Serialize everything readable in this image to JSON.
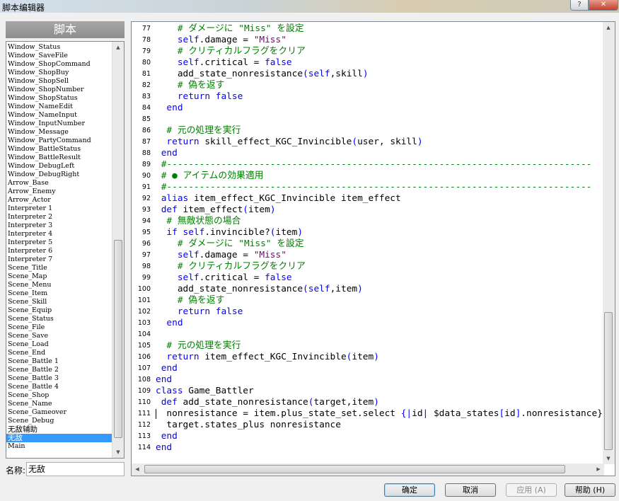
{
  "window": {
    "title": "脚本编辑器",
    "help_glyph": "?",
    "close_glyph": "✕"
  },
  "left": {
    "header": "脚本",
    "items": [
      "Window_Status",
      "Window_SaveFile",
      "Window_ShopCommand",
      "Window_ShopBuy",
      "Window_ShopSell",
      "Window_ShopNumber",
      "Window_ShopStatus",
      "Window_NameEdit",
      "Window_NameInput",
      "Window_InputNumber",
      "Window_Message",
      "Window_PartyCommand",
      "Window_BattleStatus",
      "Window_BattleResult",
      "Window_DebugLeft",
      "Window_DebugRight",
      "Arrow_Base",
      "Arrow_Enemy",
      "Arrow_Actor",
      "Interpreter 1",
      "Interpreter 2",
      "Interpreter 3",
      "Interpreter 4",
      "Interpreter 5",
      "Interpreter 6",
      "Interpreter 7",
      "Scene_Title",
      "Scene_Map",
      "Scene_Menu",
      "Scene_Item",
      "Scene_Skill",
      "Scene_Equip",
      "Scene_Status",
      "Scene_File",
      "Scene_Save",
      "Scene_Load",
      "Scene_End",
      "Scene_Battle 1",
      "Scene_Battle 2",
      "Scene_Battle 3",
      "Scene_Battle 4",
      "Scene_Shop",
      "Scene_Name",
      "Scene_Gameover",
      "Scene_Debug",
      "无敌辅助",
      "无敌",
      "Main"
    ],
    "selected_index": 46,
    "name_label": "名称:",
    "name_value": "无敌"
  },
  "editor": {
    "lines": [
      {
        "n": "77",
        "segs": [
          [
            "    # ダメージに \"Miss\" を設定",
            "#008000"
          ]
        ]
      },
      {
        "n": "78",
        "segs": [
          [
            "    self",
            "#0000ff"
          ],
          [
            ".damage = ",
            "#000000"
          ],
          [
            "\"Miss\"",
            "#800080"
          ]
        ]
      },
      {
        "n": "79",
        "segs": [
          [
            "    # クリティカルフラグをクリア",
            "#008000"
          ]
        ]
      },
      {
        "n": "80",
        "segs": [
          [
            "    self",
            "#0000ff"
          ],
          [
            ".critical = ",
            "#000000"
          ],
          [
            "false",
            "#0000ff"
          ]
        ]
      },
      {
        "n": "81",
        "segs": [
          [
            "    add_state_nonresistance",
            "#000000"
          ],
          [
            "(",
            "#0000ff"
          ],
          [
            "self",
            "#0000ff"
          ],
          [
            ",skill",
            "#000000"
          ],
          [
            ")",
            "#0000ff"
          ]
        ]
      },
      {
        "n": "82",
        "segs": [
          [
            "    # 偽を返す",
            "#008000"
          ]
        ]
      },
      {
        "n": "83",
        "segs": [
          [
            "    return false",
            "#0000ff"
          ]
        ]
      },
      {
        "n": "84",
        "segs": [
          [
            "  end",
            "#0000ff"
          ]
        ]
      },
      {
        "n": "85",
        "segs": [
          [
            "",
            "#000000"
          ]
        ]
      },
      {
        "n": "86",
        "segs": [
          [
            "  # 元の処理を実行",
            "#008000"
          ]
        ]
      },
      {
        "n": "87",
        "segs": [
          [
            "  return",
            "#0000ff"
          ],
          [
            " skill_effect_KGC_Invincible",
            "#000000"
          ],
          [
            "(",
            "#0000ff"
          ],
          [
            "user, skill",
            "#000000"
          ],
          [
            ")",
            "#0000ff"
          ]
        ]
      },
      {
        "n": "88",
        "segs": [
          [
            " end",
            "#0000ff"
          ]
        ]
      },
      {
        "n": "89",
        "segs": [
          [
            " #------------------------------------------------------------------------------",
            "#008000"
          ]
        ]
      },
      {
        "n": "90",
        "segs": [
          [
            " # ● アイテムの効果適用",
            "#008000"
          ]
        ]
      },
      {
        "n": "91",
        "segs": [
          [
            " #------------------------------------------------------------------------------",
            "#008000"
          ]
        ]
      },
      {
        "n": "92",
        "segs": [
          [
            " alias",
            "#0000ff"
          ],
          [
            " item_effect_KGC_Invincible item_effect",
            "#000000"
          ]
        ]
      },
      {
        "n": "93",
        "segs": [
          [
            " def",
            "#0000ff"
          ],
          [
            " item_effect",
            "#000000"
          ],
          [
            "(",
            "#0000ff"
          ],
          [
            "item",
            "#000000"
          ],
          [
            ")",
            "#0000ff"
          ]
        ]
      },
      {
        "n": "94",
        "segs": [
          [
            "  # 無敵状態の場合",
            "#008000"
          ]
        ]
      },
      {
        "n": "95",
        "segs": [
          [
            "  if self",
            "#0000ff"
          ],
          [
            ".invincible?",
            "#000000"
          ],
          [
            "(",
            "#0000ff"
          ],
          [
            "item",
            "#000000"
          ],
          [
            ")",
            "#0000ff"
          ]
        ]
      },
      {
        "n": "96",
        "segs": [
          [
            "    # ダメージに \"Miss\" を設定",
            "#008000"
          ]
        ]
      },
      {
        "n": "97",
        "segs": [
          [
            "    self",
            "#0000ff"
          ],
          [
            ".damage = ",
            "#000000"
          ],
          [
            "\"Miss\"",
            "#800080"
          ]
        ]
      },
      {
        "n": "98",
        "segs": [
          [
            "    # クリティカルフラグをクリア",
            "#008000"
          ]
        ]
      },
      {
        "n": "99",
        "segs": [
          [
            "    self",
            "#0000ff"
          ],
          [
            ".critical = ",
            "#000000"
          ],
          [
            "false",
            "#0000ff"
          ]
        ]
      },
      {
        "n": "100",
        "segs": [
          [
            "    add_state_nonresistance",
            "#000000"
          ],
          [
            "(",
            "#0000ff"
          ],
          [
            "self",
            "#0000ff"
          ],
          [
            ",item",
            "#000000"
          ],
          [
            ")",
            "#0000ff"
          ]
        ]
      },
      {
        "n": "101",
        "segs": [
          [
            "    # 偽を返す",
            "#008000"
          ]
        ]
      },
      {
        "n": "102",
        "segs": [
          [
            "    return false",
            "#0000ff"
          ]
        ]
      },
      {
        "n": "103",
        "segs": [
          [
            "  end",
            "#0000ff"
          ]
        ]
      },
      {
        "n": "104",
        "segs": [
          [
            "",
            "#000000"
          ]
        ]
      },
      {
        "n": "105",
        "segs": [
          [
            "  # 元の処理を実行",
            "#008000"
          ]
        ]
      },
      {
        "n": "106",
        "segs": [
          [
            "  return",
            "#0000ff"
          ],
          [
            " item_effect_KGC_Invincible",
            "#000000"
          ],
          [
            "(",
            "#0000ff"
          ],
          [
            "item",
            "#000000"
          ],
          [
            ")",
            "#0000ff"
          ]
        ]
      },
      {
        "n": "107",
        "segs": [
          [
            " end",
            "#0000ff"
          ]
        ]
      },
      {
        "n": "108",
        "segs": [
          [
            "end",
            "#0000ff"
          ]
        ]
      },
      {
        "n": "109",
        "segs": [
          [
            "class",
            "#0000ff"
          ],
          [
            " Game_Battler",
            "#000000"
          ]
        ]
      },
      {
        "n": "110",
        "segs": [
          [
            " def",
            "#0000ff"
          ],
          [
            " add_state_nonresistance",
            "#000000"
          ],
          [
            "(",
            "#0000ff"
          ],
          [
            "target,item",
            "#000000"
          ],
          [
            ")",
            "#0000ff"
          ]
        ]
      },
      {
        "n": "111",
        "segs": [
          [
            "  nonresistance = item.plus_state_set.select ",
            "#000000"
          ],
          [
            "{|",
            "#0000ff"
          ],
          [
            "id",
            "#000000"
          ],
          [
            "|",
            "#0000ff"
          ],
          [
            " $data_states",
            "#000000"
          ],
          [
            "[",
            "#0000ff"
          ],
          [
            "id",
            "#000000"
          ],
          [
            "]",
            "#0000ff"
          ],
          [
            ".nonresistance}",
            "#000000"
          ]
        ]
      },
      {
        "n": "112",
        "segs": [
          [
            "  target.states_plus nonresistance",
            "#000000"
          ]
        ]
      },
      {
        "n": "113",
        "segs": [
          [
            " end",
            "#0000ff"
          ]
        ]
      },
      {
        "n": "114",
        "segs": [
          [
            "end",
            "#0000ff"
          ]
        ]
      }
    ],
    "caret_line": "111"
  },
  "buttons": {
    "ok": "确定",
    "cancel": "取消",
    "apply": "应用 (A)",
    "help": "帮助 (H)"
  }
}
